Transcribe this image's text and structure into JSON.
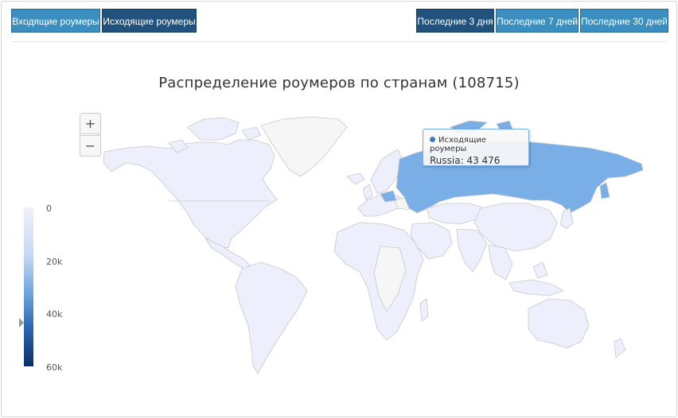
{
  "direction_tabs": [
    {
      "label": "Входящие роумеры",
      "active": false
    },
    {
      "label": "Исходящие роумеры",
      "active": true
    }
  ],
  "period_tabs": [
    {
      "label": "Последние 3 дня",
      "active": true
    },
    {
      "label": "Последние 7 дней",
      "active": false
    },
    {
      "label": "Последние 30 дней",
      "active": false
    }
  ],
  "map": {
    "title": "Распределение роумеров по странам (108715)",
    "zoom_in_label": "+",
    "zoom_out_label": "−"
  },
  "legend": {
    "labels": [
      "0",
      "20k",
      "40k",
      "60k"
    ],
    "min": 0,
    "max": 60000,
    "marker_value": 43476,
    "color_min": "#eef0fb",
    "color_max": "#0b2e6b"
  },
  "tooltip": {
    "series": "Исходящие роумеры",
    "point": "Russia: 43 476"
  },
  "colors": {
    "button_light": "#3a8fc0",
    "button_dark": "#20527d",
    "country_default": "#eeeffc",
    "country_no_data": "#f6f6f6",
    "country_highlight": "#7aaee6",
    "country_border": "#c8c8c8"
  }
}
